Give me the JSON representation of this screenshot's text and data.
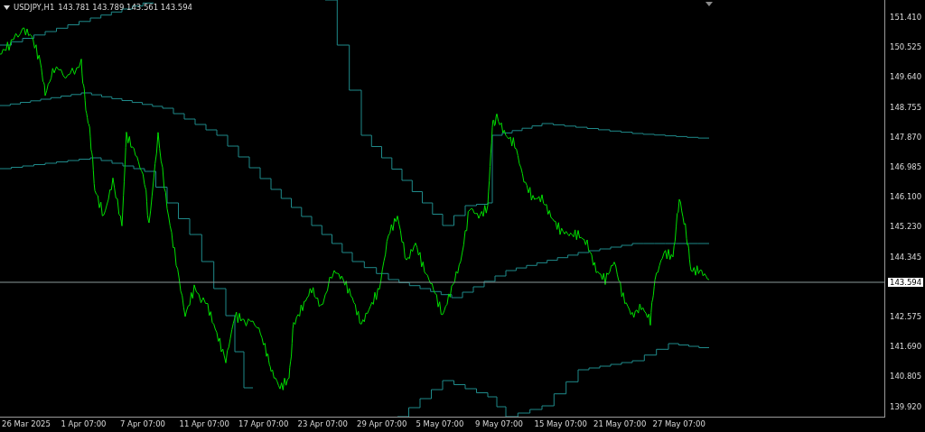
{
  "chart_header": {
    "symbol": "USDJPY,H1",
    "ohlc": "143.781 143.789 143.561 143.594"
  },
  "price_axis": [
    "151.410",
    "150.525",
    "149.640",
    "148.755",
    "147.870",
    "146.985",
    "146.100",
    "145.230",
    "144.345",
    "142.575",
    "141.690",
    "140.805",
    "139.920"
  ],
  "current_price": "143.594",
  "time_axis": [
    "26 Mar 2025",
    "1 Apr 07:00",
    "7 Apr 07:00",
    "11 Apr 07:00",
    "17 Apr 07:00",
    "23 Apr 07:00",
    "29 Apr 07:00",
    "5 May 07:00",
    "9 May 07:00",
    "15 May 07:00",
    "21 May 07:00",
    "27 May 07:00"
  ]
}
